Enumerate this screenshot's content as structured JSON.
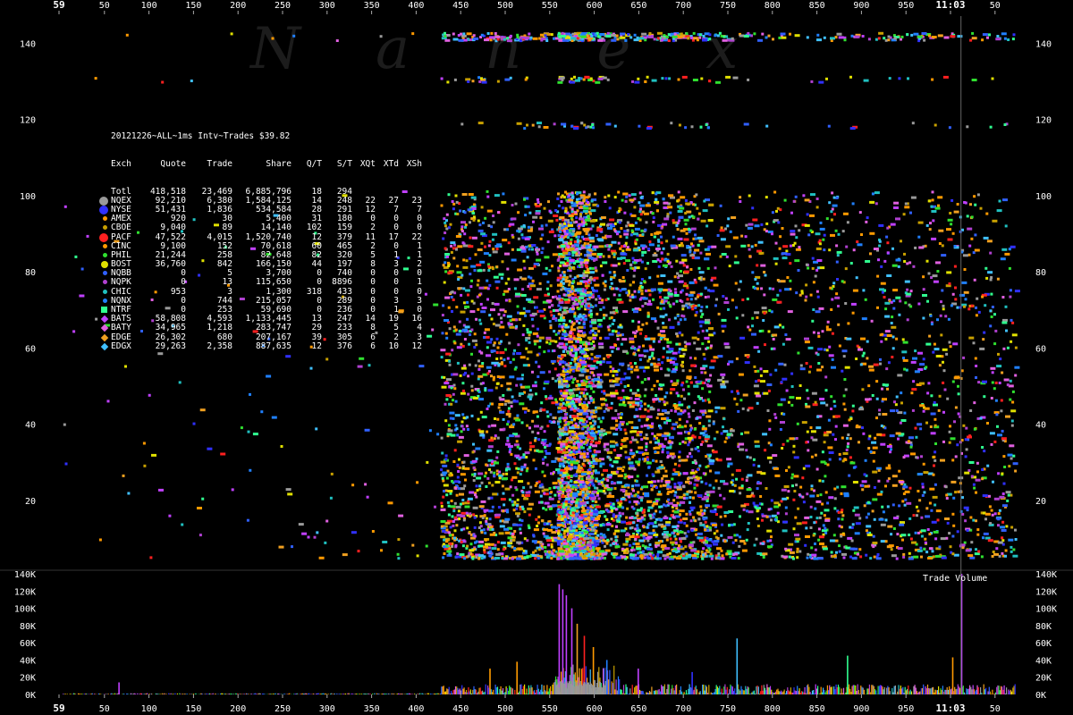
{
  "watermark": "Nanex",
  "chart_data": [
    {
      "type": "scatter",
      "title": "20121226~ALL~1ms Intv~Trades $39.82",
      "x_tick_labels_top": [
        "59",
        "50",
        "100",
        "150",
        "200",
        "250",
        "300",
        "350",
        "400",
        "450",
        "500",
        "550",
        "600",
        "650",
        "700",
        "750",
        "800",
        "850",
        "900",
        "950",
        "11:03",
        "50"
      ],
      "y_tick_labels": [
        "140",
        "120",
        "100",
        "80",
        "60",
        "40",
        "20"
      ],
      "y_ticks": [
        140,
        120,
        100,
        80,
        60,
        40,
        20
      ],
      "x_range_ms": [
        0,
        1060
      ],
      "time_marker_ms": 1000,
      "series_colors": {
        "NQEX": "#9a9a9a",
        "NYSE": "#3030ff",
        "AMEX": "#ff9900",
        "CBOE": "#c8a000",
        "PACF": "#ff2020",
        "CINC": "#ff9a00",
        "PHIL": "#30e030",
        "BOST": "#e0e000",
        "NQBB": "#3060ff",
        "NQPK": "#b040d0",
        "CHIC": "#20c0c0",
        "NQNX": "#2080ff",
        "NTRF": "#30ff90",
        "BATS": "#c040ff",
        "BATY": "#e060e0",
        "EDGE": "#f0a020",
        "EDGX": "#40c0ff"
      },
      "scatter_density": [
        {
          "from_ms": 0,
          "to_ms": 420,
          "count": 140
        },
        {
          "from_ms": 420,
          "to_ms": 550,
          "count": 1500
        },
        {
          "from_ms": 550,
          "to_ms": 590,
          "count": 2600
        },
        {
          "from_ms": 590,
          "to_ms": 720,
          "count": 2400
        },
        {
          "from_ms": 720,
          "to_ms": 1060,
          "count": 1800
        }
      ],
      "legend_header": [
        "Exch",
        "Quote",
        "Trade",
        "Share",
        "Q/T",
        "S/T",
        "XQt",
        "XTd",
        "XSh"
      ],
      "legend_rows": [
        {
          "exch": "Totl",
          "marker": "",
          "quote": "418,518",
          "trade": "23,469",
          "share": "6,885,796",
          "qt": "18",
          "st": "294",
          "xqt": "",
          "xtd": "",
          "xsh": ""
        },
        {
          "exch": "NQEX",
          "marker": "circle-lg",
          "quote": "92,210",
          "trade": "6,380",
          "share": "1,584,125",
          "qt": "14",
          "st": "248",
          "xqt": "22",
          "xtd": "27",
          "xsh": "23"
        },
        {
          "exch": "NYSE",
          "marker": "circle-lg",
          "quote": "51,431",
          "trade": "1,836",
          "share": "534,584",
          "qt": "28",
          "st": "291",
          "xqt": "12",
          "xtd": "7",
          "xsh": "7"
        },
        {
          "exch": "AMEX",
          "marker": "circle-sm",
          "quote": "920",
          "trade": "30",
          "share": "5,400",
          "qt": "31",
          "st": "180",
          "xqt": "0",
          "xtd": "0",
          "xsh": "0"
        },
        {
          "exch": "CBOE",
          "marker": "circle-sm",
          "quote": "9,040",
          "trade": "89",
          "share": "14,140",
          "qt": "102",
          "st": "159",
          "xqt": "2",
          "xtd": "0",
          "xsh": "0"
        },
        {
          "exch": "PACF",
          "marker": "circle-lg",
          "quote": "47,522",
          "trade": "4,015",
          "share": "1,520,740",
          "qt": "12",
          "st": "379",
          "xqt": "11",
          "xtd": "17",
          "xsh": "22"
        },
        {
          "exch": "CINC",
          "marker": "circle-sm",
          "quote": "9,100",
          "trade": "152",
          "share": "70,618",
          "qt": "60",
          "st": "465",
          "xqt": "2",
          "xtd": "0",
          "xsh": "1"
        },
        {
          "exch": "PHIL",
          "marker": "circle-sm",
          "quote": "21,244",
          "trade": "258",
          "share": "82,648",
          "qt": "82",
          "st": "320",
          "xqt": "5",
          "xtd": "1",
          "xsh": "1"
        },
        {
          "exch": "BOST",
          "marker": "circle-md",
          "quote": "36,760",
          "trade": "842",
          "share": "166,150",
          "qt": "44",
          "st": "197",
          "xqt": "8",
          "xtd": "3",
          "xsh": "2"
        },
        {
          "exch": "NQBB",
          "marker": "circle-sm",
          "quote": "0",
          "trade": "5",
          "share": "3,700",
          "qt": "0",
          "st": "740",
          "xqt": "0",
          "xtd": "0",
          "xsh": "0"
        },
        {
          "exch": "NQPK",
          "marker": "circle-sm",
          "quote": "0",
          "trade": "13",
          "share": "115,650",
          "qt": "0",
          "st": "8896",
          "xqt": "0",
          "xtd": "0",
          "xsh": "1"
        },
        {
          "exch": "CHIC",
          "marker": "circle-sm",
          "quote": "953",
          "trade": "3",
          "share": "1,300",
          "qt": "318",
          "st": "433",
          "xqt": "0",
          "xtd": "0",
          "xsh": "0"
        },
        {
          "exch": "NQNX",
          "marker": "circle-sm",
          "quote": "0",
          "trade": "744",
          "share": "215,057",
          "qt": "0",
          "st": "289",
          "xqt": "0",
          "xtd": "3",
          "xsh": "3"
        },
        {
          "exch": "NTRF",
          "marker": "square",
          "quote": "0",
          "trade": "253",
          "share": "59,690",
          "qt": "0",
          "st": "236",
          "xqt": "0",
          "xtd": "1",
          "xsh": "0"
        },
        {
          "exch": "BATS",
          "marker": "diamond",
          "quote": "58,808",
          "trade": "4,593",
          "share": "1,133,445",
          "qt": "13",
          "st": "247",
          "xqt": "14",
          "xtd": "19",
          "xsh": "16"
        },
        {
          "exch": "BATY",
          "marker": "diamond",
          "quote": "34,965",
          "trade": "1,218",
          "share": "283,747",
          "qt": "29",
          "st": "233",
          "xqt": "8",
          "xtd": "5",
          "xsh": "4"
        },
        {
          "exch": "EDGE",
          "marker": "diamond",
          "quote": "26,302",
          "trade": "680",
          "share": "207,167",
          "qt": "39",
          "st": "305",
          "xqt": "6",
          "xtd": "2",
          "xsh": "3"
        },
        {
          "exch": "EDGX",
          "marker": "diamond",
          "quote": "29,263",
          "trade": "2,358",
          "share": "887,635",
          "qt": "12",
          "st": "376",
          "xqt": "6",
          "xtd": "10",
          "xsh": "12"
        }
      ]
    },
    {
      "type": "bar",
      "title": "Trade Volume",
      "y_tick_labels": [
        "140K",
        "120K",
        "100K",
        "80K",
        "60K",
        "40K",
        "20K",
        "0K"
      ],
      "y_ticks": [
        140000,
        120000,
        100000,
        80000,
        60000,
        40000,
        20000,
        0
      ],
      "x_tick_labels_bottom": [
        "59",
        "50",
        "100",
        "150",
        "200",
        "250",
        "300",
        "350",
        "400",
        "450",
        "500",
        "550",
        "600",
        "650",
        "700",
        "750",
        "800",
        "850",
        "900",
        "950",
        "11:03",
        "50"
      ],
      "peaks": [
        {
          "x_ms": 62,
          "value": 14000
        },
        {
          "x_ms": 475,
          "value": 30000
        },
        {
          "x_ms": 505,
          "value": 38000
        },
        {
          "x_ms": 552,
          "value": 128000
        },
        {
          "x_ms": 556,
          "value": 122000
        },
        {
          "x_ms": 560,
          "value": 115000
        },
        {
          "x_ms": 566,
          "value": 100000
        },
        {
          "x_ms": 572,
          "value": 82000
        },
        {
          "x_ms": 580,
          "value": 68000
        },
        {
          "x_ms": 590,
          "value": 55000
        },
        {
          "x_ms": 605,
          "value": 40000
        },
        {
          "x_ms": 640,
          "value": 30000
        },
        {
          "x_ms": 700,
          "value": 26000
        },
        {
          "x_ms": 750,
          "value": 65000
        },
        {
          "x_ms": 873,
          "value": 45000
        },
        {
          "x_ms": 990,
          "value": 43000
        },
        {
          "x_ms": 1000,
          "value": 140000
        }
      ]
    }
  ]
}
